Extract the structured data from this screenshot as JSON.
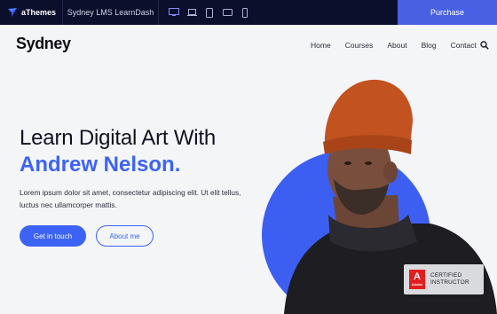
{
  "topbar": {
    "brand": "aThemes",
    "demo_name": "Sydney LMS LearnDash",
    "devices": [
      "desktop-icon",
      "laptop-icon",
      "tablet-icon",
      "tablet-landscape-icon",
      "mobile-icon"
    ],
    "purchase_label": "Purchase"
  },
  "header": {
    "logo": "Sydney",
    "nav": [
      "Home",
      "Courses",
      "About",
      "Blog",
      "Contact"
    ]
  },
  "hero": {
    "title_line1": "Learn Digital Art With",
    "title_line2": "Andrew Nelson.",
    "paragraph": "Lorem ipsum dolor sit amet, consectetur adipiscing elit. Ut elit tellus, luctus nec ullamcorper mattis.",
    "primary_button": "Get in touch",
    "secondary_button": "About me"
  },
  "badge": {
    "logo_letter": "A",
    "logo_word": "Adobe",
    "line1": "CERTIFIED",
    "line2": "INSTRUCTOR"
  },
  "colors": {
    "accent": "#3d63f5",
    "topbar_bg": "#0b0f2c",
    "purchase_bg": "#4a60e3",
    "page_bg": "#f4f5f7"
  }
}
